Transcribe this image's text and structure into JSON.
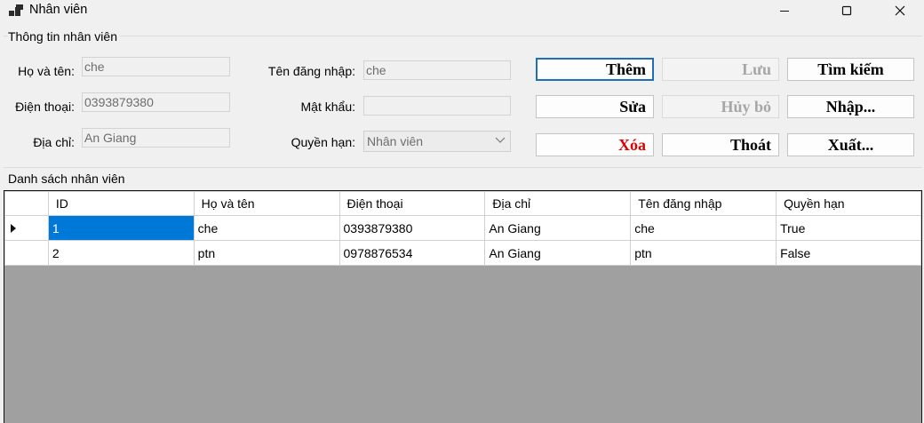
{
  "window": {
    "title": "Nhân viên"
  },
  "info_group": {
    "title": "Thông tin nhân viên"
  },
  "fields": {
    "name_label": "Họ và tên:",
    "name_value": "che",
    "phone_label": "Điện thoại:",
    "phone_value": "0393879380",
    "address_label": "Địa chỉ:",
    "address_value": "An Giang",
    "username_label": "Tên đăng nhập:",
    "username_value": "che",
    "password_label": "Mật khẩu:",
    "password_value": "",
    "role_label": "Quyền hạn:",
    "role_value": "Nhân viên"
  },
  "buttons": {
    "add": "Thêm",
    "save": "Lưu",
    "search": "Tìm kiếm",
    "edit": "Sửa",
    "cancel": "Hủy bỏ",
    "import": "Nhập...",
    "delete": "Xóa",
    "exit": "Thoát",
    "export": "Xuất..."
  },
  "colors": {
    "delete_text": "#e00000",
    "selection": "#0078d7"
  },
  "list_group": {
    "title": "Danh sách nhân viên"
  },
  "table": {
    "columns": [
      "ID",
      "Họ và tên",
      "Điện thoại",
      "Địa chỉ",
      "Tên đăng nhập",
      "Quyền hạn"
    ],
    "rows": [
      [
        "1",
        "che",
        "0393879380",
        "An Giang",
        "che",
        "True"
      ],
      [
        "2",
        "ptn",
        "0978876534",
        "An Giang",
        "ptn",
        "False"
      ]
    ],
    "selected_row": 0
  }
}
